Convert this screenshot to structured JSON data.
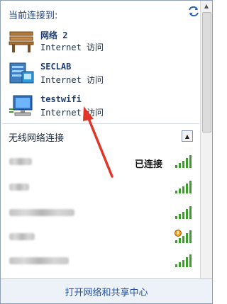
{
  "current": {
    "title": "当前连接到:",
    "refresh_icon": "refresh-icon",
    "networks": [
      {
        "name": "网络  2",
        "access": "Internet 访问",
        "icon": "bench-network-icon"
      },
      {
        "name": "SECLAB",
        "access": "Internet 访问",
        "icon": "domain-network-icon"
      },
      {
        "name": "testwifi",
        "access": "Internet 访问",
        "icon": "computer-network-icon"
      }
    ]
  },
  "wireless": {
    "title": "无线网络连接",
    "collapse_icon": "collapse-up-icon",
    "items": [
      {
        "name": "",
        "status": "已连接",
        "signal": "signal-bars-full-icon"
      },
      {
        "name": "",
        "status": "",
        "signal": "signal-bars-full-icon"
      },
      {
        "name": "",
        "status": "",
        "signal": "signal-bars-full-icon"
      },
      {
        "name": "",
        "status": "",
        "signal": "signal-secured-warning-icon"
      },
      {
        "name": "",
        "status": "",
        "signal": "signal-bars-full-icon"
      }
    ]
  },
  "footer": {
    "link": "打开网络和共享中心"
  },
  "colors": {
    "accent": "#1f4ea3",
    "signal": "#3aa02a",
    "annotation_arrow": "#e2352a"
  }
}
